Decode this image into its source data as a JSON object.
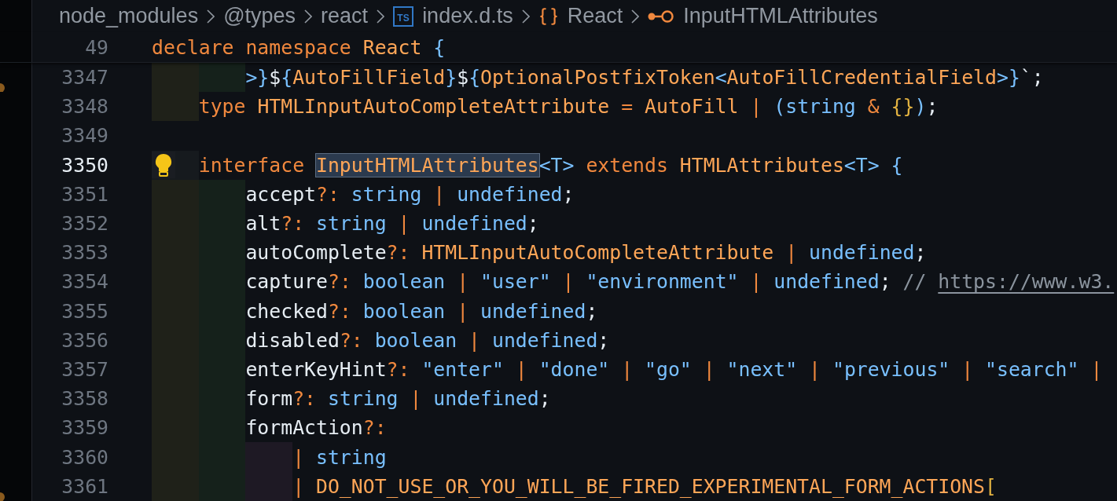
{
  "breadcrumb": [
    {
      "label": "node_modules",
      "kind": "folder"
    },
    {
      "label": "@types",
      "kind": "folder"
    },
    {
      "label": "react",
      "kind": "folder"
    },
    {
      "label": "index.d.ts",
      "kind": "file",
      "badge": "TS"
    },
    {
      "label": "React",
      "kind": "namespace"
    },
    {
      "label": "InputHTMLAttributes",
      "kind": "interface"
    }
  ],
  "sticky_line": {
    "number": "49",
    "tokens": [
      {
        "text": "declare ",
        "kind": "kw"
      },
      {
        "text": "namespace ",
        "kind": "kw"
      },
      {
        "text": "React ",
        "kind": "type"
      },
      {
        "text": "{",
        "kind": "blue"
      }
    ]
  },
  "lines": [
    {
      "number": "3347",
      "current": false,
      "marker": true,
      "guides": [
        {
          "color": "#1f2119"
        },
        {
          "color": "#15211b"
        }
      ],
      "tokens": [
        {
          "text": ">}",
          "kind": "blue"
        },
        {
          "text": "$",
          "kind": "plain"
        },
        {
          "text": "{",
          "kind": "blue"
        },
        {
          "text": "AutoFillField",
          "kind": "type"
        },
        {
          "text": "}",
          "kind": "blue"
        },
        {
          "text": "$",
          "kind": "plain"
        },
        {
          "text": "{",
          "kind": "blue"
        },
        {
          "text": "OptionalPostfixToken",
          "kind": "type"
        },
        {
          "text": "<",
          "kind": "blue"
        },
        {
          "text": "AutoFillCredentialField",
          "kind": "type"
        },
        {
          "text": ">}",
          "kind": "blue"
        },
        {
          "text": "`;",
          "kind": "plain"
        }
      ]
    },
    {
      "number": "3348",
      "current": false,
      "marker": false,
      "guides": [
        {
          "color": "#1f2119"
        }
      ],
      "tokens": [
        {
          "text": "type ",
          "kind": "kw"
        },
        {
          "text": "HTMLInputAutoCompleteAttribute ",
          "kind": "type"
        },
        {
          "text": "= ",
          "kind": "kw"
        },
        {
          "text": "AutoFill ",
          "kind": "type"
        },
        {
          "text": "| ",
          "kind": "kw"
        },
        {
          "text": "(",
          "kind": "blue"
        },
        {
          "text": "string ",
          "kind": "blue"
        },
        {
          "text": "& ",
          "kind": "kw"
        },
        {
          "text": "{}",
          "kind": "bracket"
        },
        {
          "text": ")",
          "kind": "blue"
        },
        {
          "text": ";",
          "kind": "plain"
        }
      ]
    },
    {
      "number": "3349",
      "current": false,
      "marker": false
    },
    {
      "number": "3350",
      "current": true,
      "marker": false,
      "guides": [
        {
          "color": "#161a1e"
        }
      ],
      "tokens": [
        {
          "text": "interface ",
          "kind": "kw"
        },
        {
          "text": "InputHTMLAttributes",
          "kind": "symbol-highlight"
        },
        {
          "text": "<T> ",
          "kind": "blue"
        },
        {
          "text": "extends ",
          "kind": "kw"
        },
        {
          "text": "HTMLAttributes",
          "kind": "type"
        },
        {
          "text": "<T> ",
          "kind": "blue"
        },
        {
          "text": "{",
          "kind": "blue"
        }
      ]
    },
    {
      "number": "3351",
      "current": false,
      "marker": false,
      "guides": [
        {
          "color": "#1f2119"
        },
        {
          "color": "#15211b"
        }
      ],
      "tokens": [
        {
          "text": "accept",
          "kind": "plain"
        },
        {
          "text": "?: ",
          "kind": "kw"
        },
        {
          "text": "string ",
          "kind": "blue"
        },
        {
          "text": "| ",
          "kind": "kw"
        },
        {
          "text": "undefined",
          "kind": "blue"
        },
        {
          "text": ";",
          "kind": "plain"
        }
      ]
    },
    {
      "number": "3352",
      "current": false,
      "marker": false,
      "guides": [
        {
          "color": "#1f2119"
        },
        {
          "color": "#15211b"
        }
      ],
      "tokens": [
        {
          "text": "alt",
          "kind": "plain"
        },
        {
          "text": "?: ",
          "kind": "kw"
        },
        {
          "text": "string ",
          "kind": "blue"
        },
        {
          "text": "| ",
          "kind": "kw"
        },
        {
          "text": "undefined",
          "kind": "blue"
        },
        {
          "text": ";",
          "kind": "plain"
        }
      ]
    },
    {
      "number": "3353",
      "current": false,
      "marker": false,
      "guides": [
        {
          "color": "#1f2119"
        },
        {
          "color": "#15211b"
        }
      ],
      "tokens": [
        {
          "text": "autoComplete",
          "kind": "plain"
        },
        {
          "text": "?: ",
          "kind": "kw"
        },
        {
          "text": "HTMLInputAutoCompleteAttribute ",
          "kind": "type"
        },
        {
          "text": "| ",
          "kind": "kw"
        },
        {
          "text": "undefined",
          "kind": "blue"
        },
        {
          "text": ";",
          "kind": "plain"
        }
      ]
    },
    {
      "number": "3354",
      "current": false,
      "marker": false,
      "guides": [
        {
          "color": "#1f2119"
        },
        {
          "color": "#15211b"
        }
      ],
      "tokens": [
        {
          "text": "capture",
          "kind": "plain"
        },
        {
          "text": "?: ",
          "kind": "kw"
        },
        {
          "text": "boolean ",
          "kind": "blue"
        },
        {
          "text": "| ",
          "kind": "kw"
        },
        {
          "text": "\"user\" ",
          "kind": "blue"
        },
        {
          "text": "| ",
          "kind": "kw"
        },
        {
          "text": "\"environment\" ",
          "kind": "blue"
        },
        {
          "text": "| ",
          "kind": "kw"
        },
        {
          "text": "undefined",
          "kind": "blue"
        },
        {
          "text": "; ",
          "kind": "plain"
        },
        {
          "text": "// ",
          "kind": "comment"
        },
        {
          "text": "https://www.w3.",
          "kind": "link"
        }
      ]
    },
    {
      "number": "3355",
      "current": false,
      "marker": false,
      "guides": [
        {
          "color": "#1f2119"
        },
        {
          "color": "#15211b"
        }
      ],
      "tokens": [
        {
          "text": "checked",
          "kind": "plain"
        },
        {
          "text": "?: ",
          "kind": "kw"
        },
        {
          "text": "boolean ",
          "kind": "blue"
        },
        {
          "text": "| ",
          "kind": "kw"
        },
        {
          "text": "undefined",
          "kind": "blue"
        },
        {
          "text": ";",
          "kind": "plain"
        }
      ]
    },
    {
      "number": "3356",
      "current": false,
      "marker": false,
      "guides": [
        {
          "color": "#1f2119"
        },
        {
          "color": "#15211b"
        }
      ],
      "tokens": [
        {
          "text": "disabled",
          "kind": "plain"
        },
        {
          "text": "?: ",
          "kind": "kw"
        },
        {
          "text": "boolean ",
          "kind": "blue"
        },
        {
          "text": "| ",
          "kind": "kw"
        },
        {
          "text": "undefined",
          "kind": "blue"
        },
        {
          "text": ";",
          "kind": "plain"
        }
      ]
    },
    {
      "number": "3357",
      "current": false,
      "marker": false,
      "guides": [
        {
          "color": "#1f2119"
        },
        {
          "color": "#15211b"
        }
      ],
      "tokens": [
        {
          "text": "enterKeyHint",
          "kind": "plain"
        },
        {
          "text": "?: ",
          "kind": "kw"
        },
        {
          "text": "\"enter\" ",
          "kind": "blue"
        },
        {
          "text": "| ",
          "kind": "kw"
        },
        {
          "text": "\"done\" ",
          "kind": "blue"
        },
        {
          "text": "| ",
          "kind": "kw"
        },
        {
          "text": "\"go\" ",
          "kind": "blue"
        },
        {
          "text": "| ",
          "kind": "kw"
        },
        {
          "text": "\"next\" ",
          "kind": "blue"
        },
        {
          "text": "| ",
          "kind": "kw"
        },
        {
          "text": "\"previous\" ",
          "kind": "blue"
        },
        {
          "text": "| ",
          "kind": "kw"
        },
        {
          "text": "\"search\" ",
          "kind": "blue"
        },
        {
          "text": "|",
          "kind": "kw"
        }
      ]
    },
    {
      "number": "3358",
      "current": false,
      "marker": false,
      "guides": [
        {
          "color": "#1f2119"
        },
        {
          "color": "#15211b"
        }
      ],
      "tokens": [
        {
          "text": "form",
          "kind": "plain"
        },
        {
          "text": "?: ",
          "kind": "kw"
        },
        {
          "text": "string ",
          "kind": "blue"
        },
        {
          "text": "| ",
          "kind": "kw"
        },
        {
          "text": "undefined",
          "kind": "blue"
        },
        {
          "text": ";",
          "kind": "plain"
        }
      ]
    },
    {
      "number": "3359",
      "current": false,
      "marker": false,
      "guides": [
        {
          "color": "#1f2119"
        },
        {
          "color": "#15211b"
        }
      ],
      "tokens": [
        {
          "text": "formAction",
          "kind": "plain"
        },
        {
          "text": "?:",
          "kind": "kw"
        }
      ]
    },
    {
      "number": "3360",
      "current": false,
      "marker": false,
      "guides": [
        {
          "color": "#1f2119"
        },
        {
          "color": "#15211b"
        },
        {
          "color": "#1e1924"
        }
      ],
      "tokens": [
        {
          "text": "| ",
          "kind": "kw"
        },
        {
          "text": "string",
          "kind": "blue"
        }
      ]
    },
    {
      "number": "3361",
      "current": false,
      "marker": true,
      "guides": [
        {
          "color": "#1f2119"
        },
        {
          "color": "#15211b"
        },
        {
          "color": "#1e1924"
        }
      ],
      "tokens": [
        {
          "text": "| ",
          "kind": "kw"
        },
        {
          "text": "DO_NOT_USE_OR_YOU_WILL_BE_FIRED_EXPERIMENTAL_FORM_ACTIONS",
          "kind": "type"
        },
        {
          "text": "[",
          "kind": "bracket"
        }
      ]
    }
  ]
}
